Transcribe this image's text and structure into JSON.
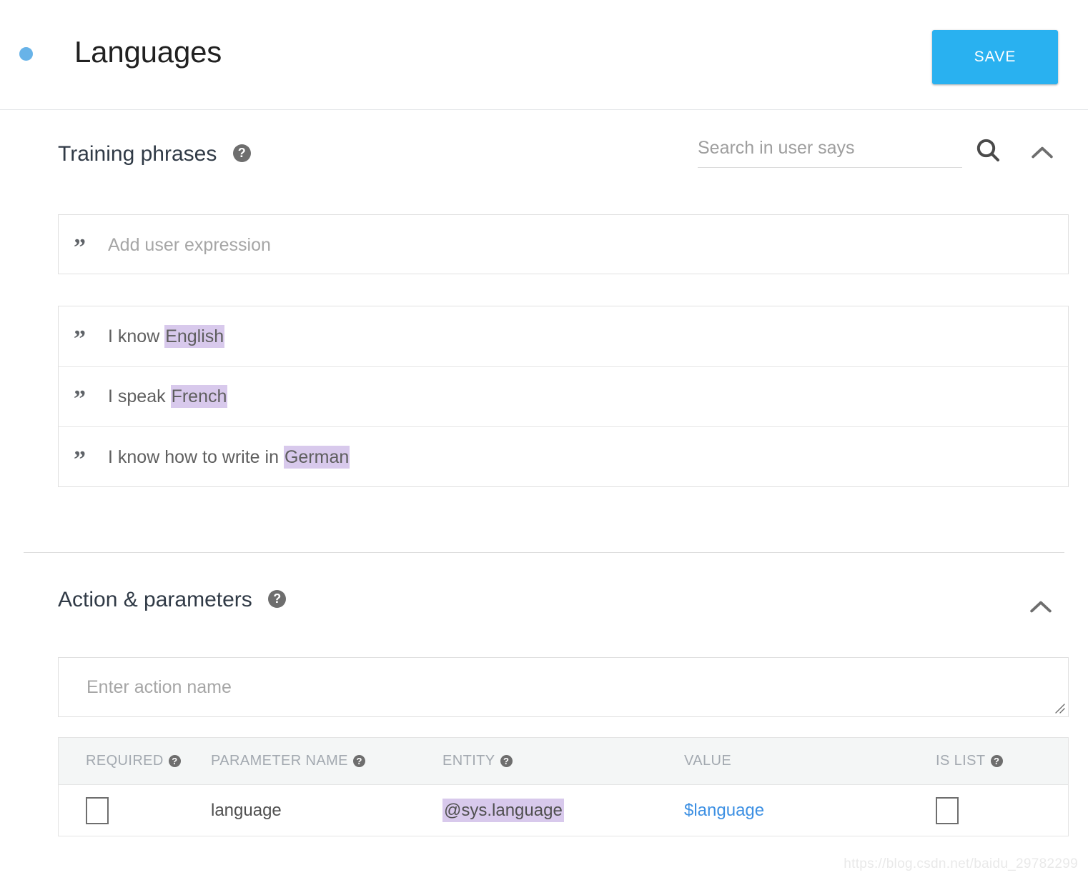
{
  "header": {
    "title": "Languages",
    "status_dot_color": "#68b3e8",
    "save_label": "SAVE",
    "save_color": "#29b1f0"
  },
  "training_phrases": {
    "title": "Training phrases",
    "help_glyph": "?",
    "search": {
      "placeholder": "Search in user says",
      "value": "",
      "icon": "search-icon"
    },
    "collapse_icon": "chevron-up-icon",
    "add_expression": {
      "quote_glyph": "”",
      "placeholder": "Add user expression",
      "value": ""
    },
    "highlight_color": "#d8c9ec",
    "phrases": [
      {
        "quote_glyph": "”",
        "prefix": "I know ",
        "entity": "English",
        "suffix": ""
      },
      {
        "quote_glyph": "”",
        "prefix": "I speak ",
        "entity": "French",
        "suffix": ""
      },
      {
        "quote_glyph": "”",
        "prefix": "I know how to write in ",
        "entity": "German",
        "suffix": ""
      }
    ]
  },
  "action_parameters": {
    "title": "Action & parameters",
    "help_glyph": "?",
    "collapse_icon": "chevron-up-icon",
    "action_name": {
      "placeholder": "Enter action name",
      "value": ""
    },
    "table": {
      "columns": [
        {
          "label": "REQUIRED",
          "help": true
        },
        {
          "label": "PARAMETER NAME",
          "help": true
        },
        {
          "label": "ENTITY",
          "help": true
        },
        {
          "label": "VALUE",
          "help": false
        },
        {
          "label": "IS LIST",
          "help": true
        }
      ],
      "help_glyph": "?",
      "rows": [
        {
          "required": false,
          "parameter_name": "language",
          "entity": "@sys.language",
          "value": "$language",
          "is_list": false
        }
      ]
    }
  },
  "watermark": "https://blog.csdn.net/baidu_29782299"
}
